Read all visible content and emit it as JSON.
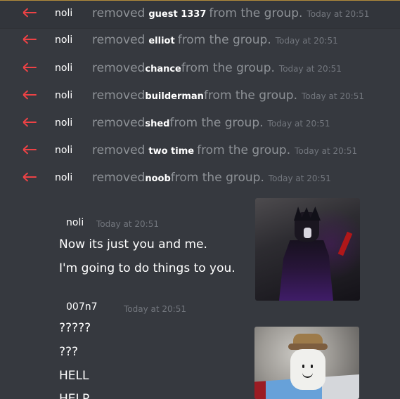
{
  "system_messages": [
    {
      "actor": "noli",
      "action": "removed",
      "target": "guest 1337",
      "suffix": "from the group.",
      "time": "Today at 20:51",
      "arrow_icon": "left-arrow-icon",
      "highlighted": true
    },
    {
      "actor": "noli",
      "action": "removed",
      "target": "elliot",
      "suffix": "from the group.",
      "time": "Today at 20:51",
      "arrow_icon": "left-arrow-icon"
    },
    {
      "actor": "noli",
      "action": "removed",
      "target": "chance",
      "suffix": "from the group.",
      "time": "Today at 20:51",
      "arrow_icon": "left-arrow-icon"
    },
    {
      "actor": "noli",
      "action": "removed",
      "target": "builderman",
      "suffix": "from the group.",
      "time": "Today at 20:51",
      "arrow_icon": "left-arrow-icon"
    },
    {
      "actor": "noli",
      "action": "removed",
      "target": "shed",
      "suffix": "from the group.",
      "time": "Today at 20:51",
      "arrow_icon": "left-arrow-icon"
    },
    {
      "actor": "noli",
      "action": "removed",
      "target": "two time",
      "suffix": "from the group.",
      "time": "Today at 20:51",
      "arrow_icon": "left-arrow-icon"
    },
    {
      "actor": "noli",
      "action": "removed",
      "target": "noob",
      "suffix": "from the group.",
      "time": "Today at 20:51",
      "arrow_icon": "left-arrow-icon"
    }
  ],
  "messages": [
    {
      "author": "noli",
      "time": "Today at 20:51",
      "lines": [
        "Now its just you and me.",
        "I'm going to do things to you."
      ]
    },
    {
      "author": "007n7",
      "time": "Today at 20:51",
      "lines": [
        "?????",
        "???",
        "HELL",
        "HELP"
      ]
    }
  ],
  "colors": {
    "background": "#36393f",
    "removal_arrow": "#ed4245",
    "muted_text": "#8e9297",
    "timestamp": "#72767d",
    "highlight_border": "#b28b3b"
  }
}
